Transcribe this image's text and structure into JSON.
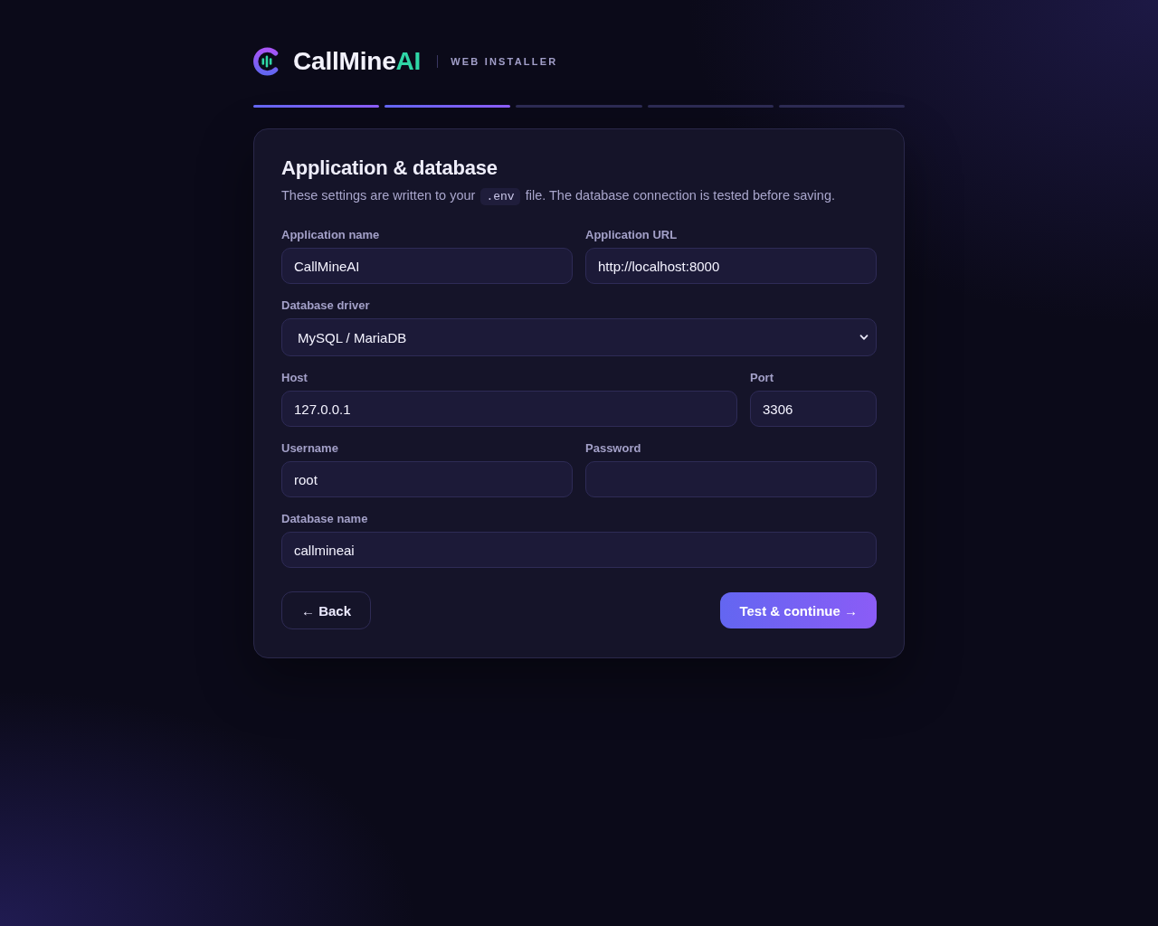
{
  "brand": {
    "name": "CallMine",
    "accent": "AI",
    "tagline": "WEB INSTALLER"
  },
  "steps": [
    {
      "done": true
    },
    {
      "done": true
    },
    {
      "done": false
    },
    {
      "done": false
    },
    {
      "done": false
    }
  ],
  "card": {
    "title": "Application & database",
    "description": [
      {
        "kind": "text",
        "text": "These settings are written to your"
      },
      {
        "kind": "code",
        "text": ".env"
      },
      {
        "kind": "text",
        "text": "file. The database connection is tested before saving."
      }
    ]
  },
  "form": {
    "rows": [
      [
        {
          "label": "Application name",
          "kind": "text",
          "value": "CallMineAI"
        },
        {
          "label": "Application URL",
          "kind": "text",
          "value": "http://localhost:8000"
        }
      ],
      [
        {
          "label": "Database driver",
          "kind": "select",
          "value": "MySQL / MariaDB"
        }
      ],
      [
        {
          "label": "Host",
          "kind": "text",
          "value": "127.0.0.1"
        },
        {
          "label": "Port",
          "kind": "number",
          "value": "3306"
        }
      ],
      [
        {
          "label": "Username",
          "kind": "text",
          "value": "root"
        },
        {
          "label": "Password",
          "kind": "password"
        }
      ],
      [
        {
          "label": "Database name",
          "kind": "text",
          "value": "callmineai"
        }
      ]
    ]
  },
  "buttons": [
    {
      "label": "← Back",
      "kind": "back"
    },
    {
      "label": "Test & continue →",
      "kind": "submit"
    }
  ]
}
